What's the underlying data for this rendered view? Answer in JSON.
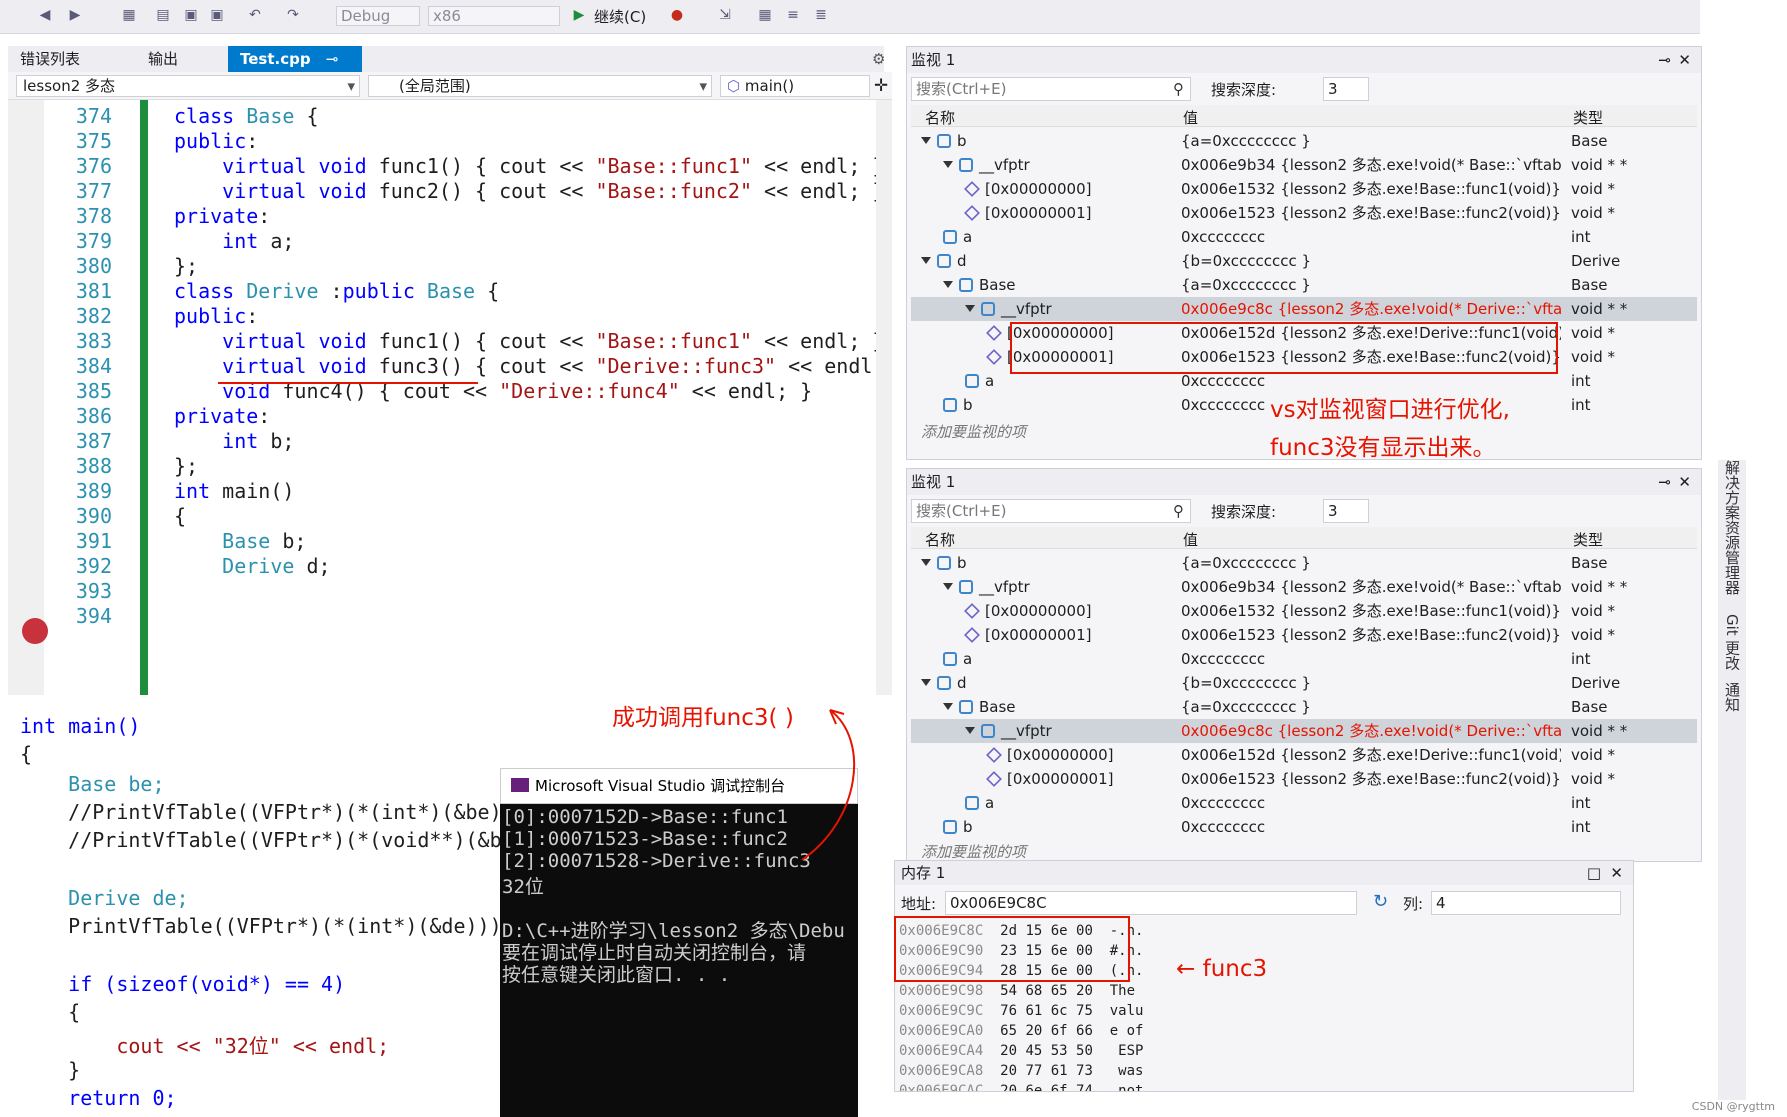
{
  "toolbar": {
    "config_combo": "Debug",
    "platform_combo": "x86",
    "continue_label": "继续(C)"
  },
  "tabs": [
    {
      "label": "错误列表",
      "active": false
    },
    {
      "label": "输出",
      "active": false
    },
    {
      "label": "Test.cpp",
      "active": true
    }
  ],
  "navbar": {
    "project": "lesson2 多态",
    "scope": "(全局范围)",
    "member": "main()"
  },
  "editor_top": {
    "line_numbers": [
      "374",
      "375",
      "376",
      "377",
      "378",
      "379",
      "380",
      "381",
      "382",
      "383",
      "384",
      "385",
      "386",
      "387",
      "388",
      "389",
      "390",
      "391",
      "392",
      "393",
      "394"
    ],
    "breakpoint_line": "392"
  },
  "editor_bottom": {
    "lines": [
      "int main()",
      "{",
      "    Base be;",
      "    //PrintVfTable((VFPtr*)(*(int*)(&be)));",
      "    //PrintVfTable((VFPtr*)(*(void**)(&be",
      "",
      "    Derive de;",
      "    PrintVfTable((VFPtr*)(*(int*)(&de)));",
      "",
      "    if (sizeof(void*) == 4)",
      "    {",
      "        cout << \"32位\" << endl;",
      "    }",
      "    return 0;"
    ]
  },
  "console": {
    "title": "Microsoft Visual Studio 调试控制台",
    "lines": [
      "[0]:0007152D->Base::func1",
      "[1]:00071523->Base::func2",
      "[2]:00071528->Derive::func3",
      "32位",
      "",
      "D:\\C++进阶学习\\lesson2 多态\\Debu",
      "要在调试停止时自动关闭控制台，请",
      "按任意键关闭此窗口. . ."
    ]
  },
  "watch_common": {
    "title": "监视 1",
    "search_placeholder": "搜索(Ctrl+E)",
    "depth_label": "搜索深度:",
    "depth_value": "3",
    "col_name": "名称",
    "col_value": "值",
    "col_type": "类型",
    "add_hint": "添加要监视的项"
  },
  "watch1_rows": [
    {
      "name": "b",
      "value": "{a=0xcccccccc }",
      "type": "Base",
      "indent": 0,
      "icon": "var",
      "expand": true,
      "red": false,
      "sel": false
    },
    {
      "name": "__vfptr",
      "value": "0x006e9b34 {lesson2 多态.exe!void(* Base::`vftab...",
      "type": "void * *",
      "indent": 1,
      "icon": "var",
      "expand": true,
      "red": false,
      "sel": false
    },
    {
      "name": "[0x00000000]",
      "value": "0x006e1532 {lesson2 多态.exe!Base::func1(void)}",
      "type": "void *",
      "indent": 2,
      "icon": "cube",
      "expand": false,
      "red": false,
      "sel": false
    },
    {
      "name": "[0x00000001]",
      "value": "0x006e1523 {lesson2 多态.exe!Base::func2(void)}",
      "type": "void *",
      "indent": 2,
      "icon": "cube",
      "expand": false,
      "red": false,
      "sel": false
    },
    {
      "name": "a",
      "value": "0xcccccccc",
      "type": "int",
      "indent": 1,
      "icon": "var",
      "expand": false,
      "red": false,
      "sel": false
    },
    {
      "name": "d",
      "value": "{b=0xcccccccc }",
      "type": "Derive",
      "indent": 0,
      "icon": "var",
      "expand": true,
      "red": false,
      "sel": false
    },
    {
      "name": "Base",
      "value": "{a=0xcccccccc }",
      "type": "Base",
      "indent": 1,
      "icon": "var",
      "expand": true,
      "red": false,
      "sel": false
    },
    {
      "name": "__vfptr",
      "value": "0x006e9c8c {lesson2 多态.exe!void(* Derive::`vfta...",
      "type": "void * *",
      "indent": 2,
      "icon": "var",
      "expand": true,
      "red": true,
      "sel": true
    },
    {
      "name": "[0x00000000]",
      "value": "0x006e152d {lesson2 多态.exe!Derive::func1(void)}",
      "type": "void *",
      "indent": 3,
      "icon": "cube",
      "expand": false,
      "red": false,
      "sel": false
    },
    {
      "name": "[0x00000001]",
      "value": "0x006e1523 {lesson2 多态.exe!Base::func2(void)}",
      "type": "void *",
      "indent": 3,
      "icon": "cube",
      "expand": false,
      "red": false,
      "sel": false
    },
    {
      "name": "a",
      "value": "0xcccccccc",
      "type": "int",
      "indent": 2,
      "icon": "var",
      "expand": false,
      "red": false,
      "sel": false
    },
    {
      "name": "b",
      "value": "0xcccccccc",
      "type": "int",
      "indent": 1,
      "icon": "var",
      "expand": false,
      "red": false,
      "sel": false
    }
  ],
  "memory": {
    "title": "内存 1",
    "address_label": "地址:",
    "address_value": "0x006E9C8C",
    "col_label": "列:",
    "col_value": "4",
    "lines": [
      "0x006E9C8C  2d 15 6e 00  -.n.",
      "0x006E9C90  23 15 6e 00  #.n.",
      "0x006E9C94  28 15 6e 00  (.n.",
      "0x006E9C98  54 68 65 20  The ",
      "0x006E9C9C  76 61 6c 75  valu",
      "0x006E9CA0  65 20 6f 66  e of",
      "0x006E9CA4  20 45 53 50   ESP",
      "0x006E9CA8  20 77 61 73   was",
      "0x006E9CAC  20 6e 6f 74   not"
    ]
  },
  "annotations": {
    "call_success": "成功调用func3( )",
    "optimize_1": "vs对监视窗口进行优化,",
    "optimize_2": "func3没有显示出来。",
    "func3_label": "func3"
  },
  "side_rail": [
    "解决方案资源管理器",
    "Git 更改",
    "通知"
  ],
  "watermark": "CSDN @rygttm"
}
